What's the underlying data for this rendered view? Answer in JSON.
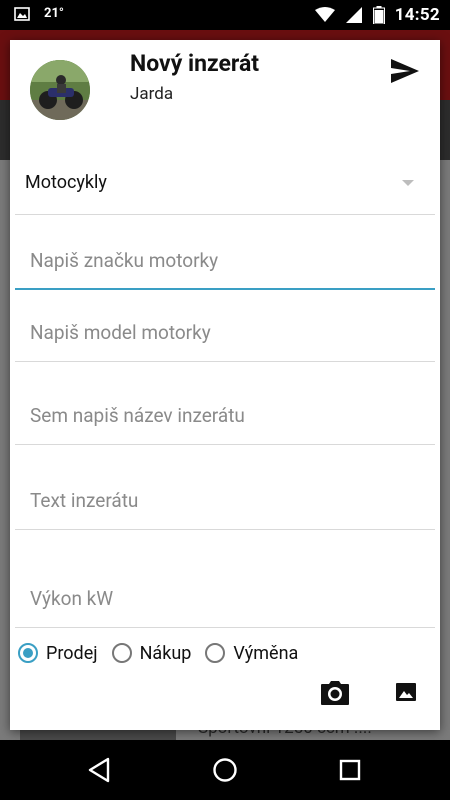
{
  "status_bar": {
    "temperature": "21°",
    "time": "14:52",
    "icons": [
      "image-notification-icon",
      "wifi-icon",
      "signal-icon",
      "battery-icon"
    ]
  },
  "background": {
    "text": "Sportovní 1250 ccm ...."
  },
  "dialog": {
    "title": "Nový inzerát",
    "user": "Jarda",
    "send_icon": "send-icon",
    "category_selected": "Motocykly",
    "fields": {
      "brand_placeholder": "Napiš značku motorky",
      "model_placeholder": "Napiš model motorky",
      "ad_title_placeholder": "Sem napiš název inzerátu",
      "ad_text_placeholder": "Text inzerátu",
      "power_placeholder": "Výkon kW"
    },
    "radios": [
      {
        "label": "Prodej",
        "selected": true
      },
      {
        "label": "Nákup",
        "selected": false
      },
      {
        "label": "Výměna",
        "selected": false
      }
    ],
    "bottom_icons": [
      "camera-icon",
      "gallery-icon"
    ]
  },
  "colors": {
    "accent": "#3a9fc4",
    "status_bar": "#000000",
    "nav_bar": "#000000"
  }
}
